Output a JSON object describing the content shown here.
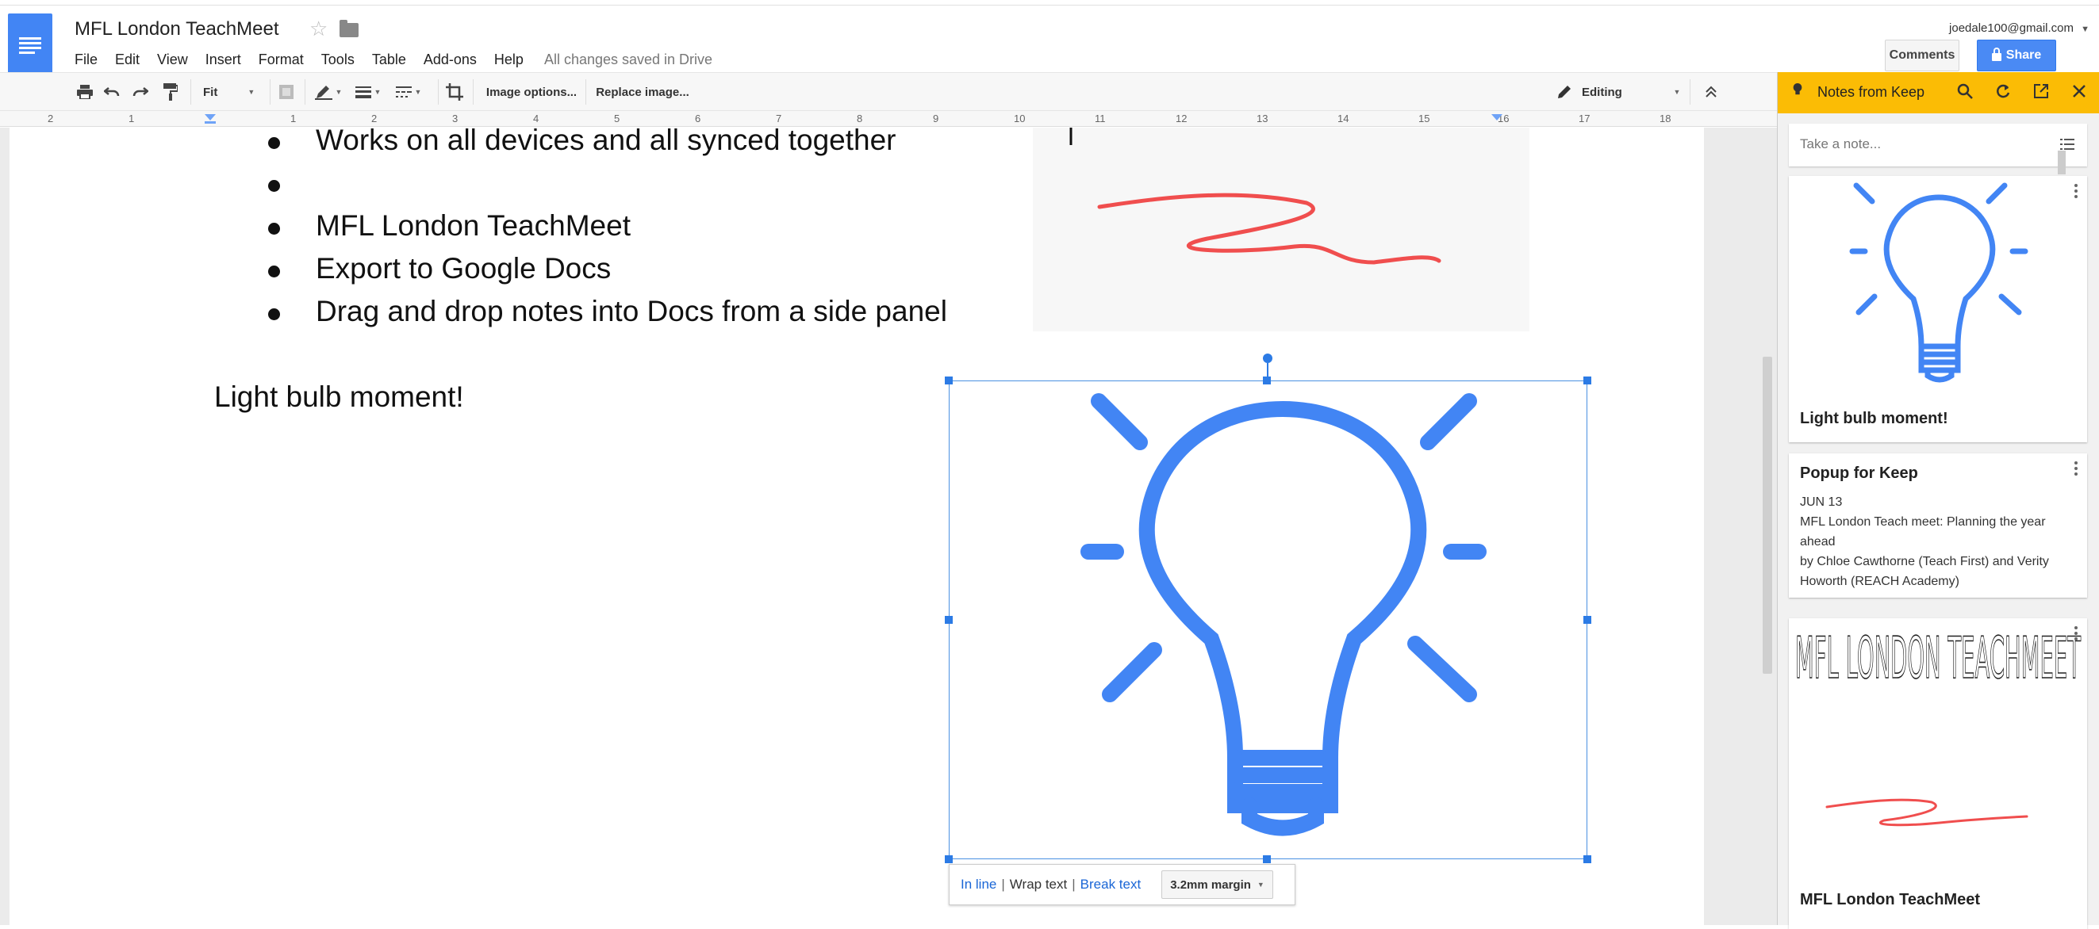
{
  "app": {
    "doc_title": "MFL London TeachMeet",
    "menu": [
      "File",
      "Edit",
      "View",
      "Insert",
      "Format",
      "Tools",
      "Table",
      "Add-ons",
      "Help"
    ],
    "save_status": "All changes saved in Drive",
    "account": "joedale100@gmail.com",
    "comments_label": "Comments",
    "share_label": "Share"
  },
  "toolbar": {
    "zoom": "Fit",
    "image_options": "Image options...",
    "replace_image": "Replace image...",
    "mode": "Editing"
  },
  "ruler": {
    "labels": [
      "2",
      "1",
      "1",
      "2",
      "3",
      "4",
      "5",
      "6",
      "7",
      "8",
      "9",
      "10",
      "11",
      "12",
      "13",
      "14",
      "15",
      "16",
      "17",
      "18"
    ]
  },
  "document": {
    "bullets": [
      "Works on all devices and all synced together",
      "",
      "MFL London TeachMeet",
      "Export to Google Docs",
      "Drag and drop notes into Docs from a side panel"
    ],
    "caption": "Light bulb moment!",
    "image_bar": {
      "inline": "In line",
      "wrap": "Wrap text",
      "break": "Break text",
      "margin": "3.2mm margin"
    }
  },
  "keep": {
    "title": "Notes from Keep",
    "take_note_placeholder": "Take a note...",
    "cards": [
      {
        "title": "Light bulb moment!"
      },
      {
        "title": "Popup for Keep",
        "date": "JUN 13",
        "lines": [
          "MFL London Teach meet: Planning the year ahead",
          "by Chloe Cawthorne (Teach First) and Verity Howorth (REACH Academy)"
        ]
      },
      {
        "title": "MFL London TeachMeet",
        "handwriting": "MFL LONDON TEACHMEET"
      }
    ]
  },
  "colors": {
    "brand_blue": "#4285f4",
    "keep_yellow": "#fbbc05",
    "bulb_blue": "#4285f4",
    "scribble_red": "#f04e4e"
  }
}
